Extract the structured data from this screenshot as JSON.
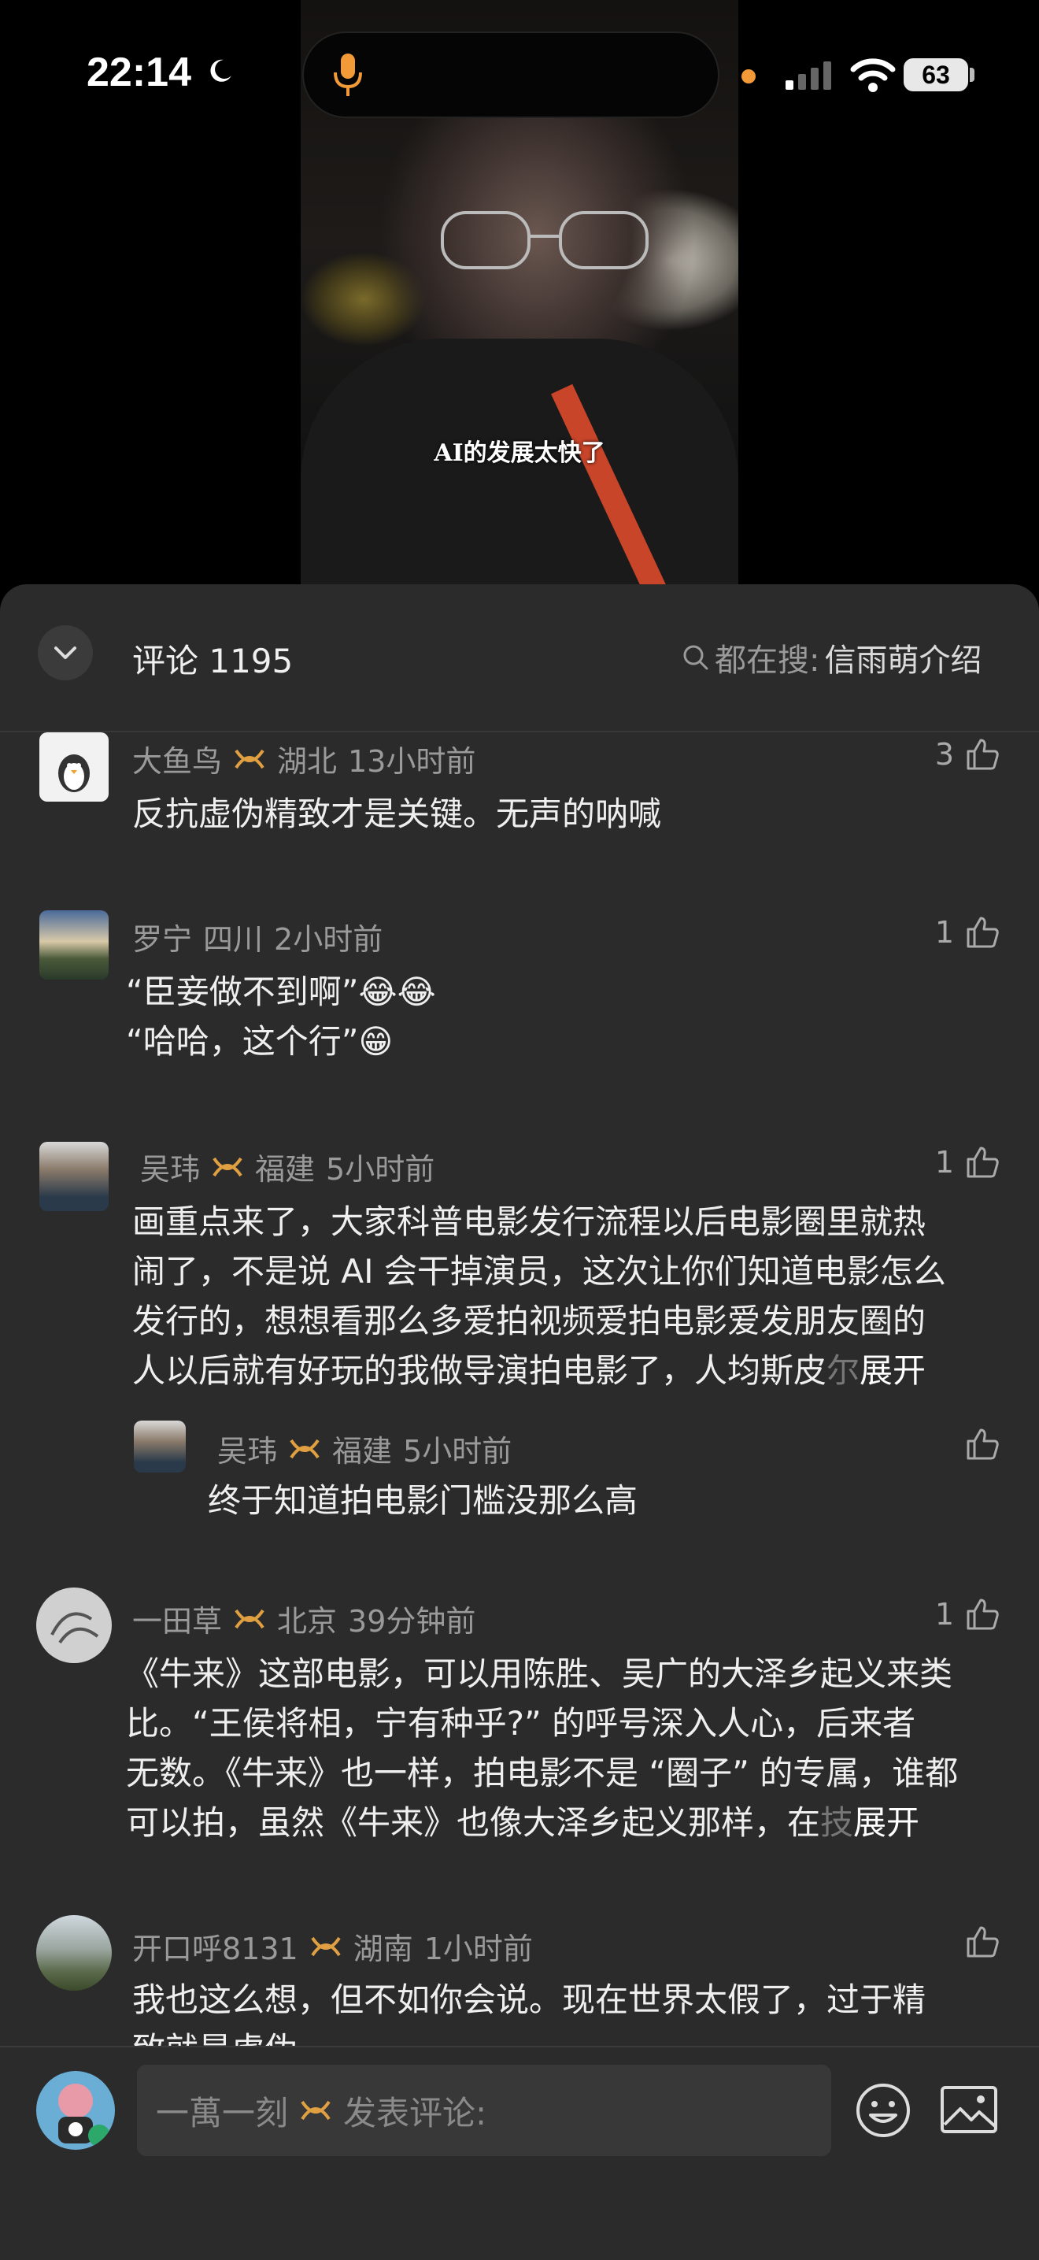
{
  "status_bar": {
    "time": "22:14",
    "battery": "63"
  },
  "video": {
    "caption": "AI的发展太快了"
  },
  "header": {
    "title": "评论 1195",
    "search_prefix": "都在搜:",
    "search_term": "信雨萌介绍"
  },
  "comments": [
    {
      "user": "大鱼鸟",
      "location": "湖北",
      "time": "13小时前",
      "likes": "3",
      "lines": [
        "反抗虚伪精致才是关键。无声的呐喊"
      ]
    },
    {
      "user": "罗宁",
      "location": "四川",
      "time": "2小时前",
      "likes": "1",
      "lines": [
        "“臣妾做不到啊”",
        "“哈哈，这个行”"
      ]
    },
    {
      "user": "吴玮",
      "location": "福建",
      "time": "5小时前",
      "likes": "1",
      "lines": [
        "画重点来了，大家科普电影发行流程以后电影圈里就热",
        "闹了，不是说 AI 会干掉演员，这次让你们知道电影怎么",
        "发行的，想想看那么多爱拍视频爱拍电影爱发朋友圈的",
        "人以后就有好玩的我做导演拍电影了，人均斯皮"
      ],
      "fade": "尔",
      "expand": "展开"
    },
    {
      "user": "吴玮",
      "location": "福建",
      "time": "5小时前",
      "likes": "",
      "lines": [
        "终于知道拍电影门槛没那么高"
      ]
    },
    {
      "user": "一田草",
      "location": "北京",
      "time": "39分钟前",
      "likes": "1",
      "lines": [
        "《牛来》这部电影，可以用陈胜、吴广的大泽乡起义来类",
        "比。“王侯将相，宁有种乎?” 的呼号深入人心，后来者",
        "无数。《牛来》也一样，拍电影不是 “圈子” 的专属，谁都",
        "可以拍，虽然《牛来》也像大泽乡起义那样，在"
      ],
      "fade": "技",
      "expand": "展开"
    },
    {
      "user": "开口呼8131",
      "location": "湖南",
      "time": "1小时前",
      "likes": "",
      "lines": [
        "我也这么想，但不如你会说。现在世界太假了，过于精",
        "致就是虚伪"
      ]
    }
  ],
  "input": {
    "username": "一萬一刻",
    "placeholder": "发表评论:"
  },
  "colors": {
    "sheet": "#2b2b2b",
    "accent": "#f29a38",
    "vip": "#e0a042"
  }
}
